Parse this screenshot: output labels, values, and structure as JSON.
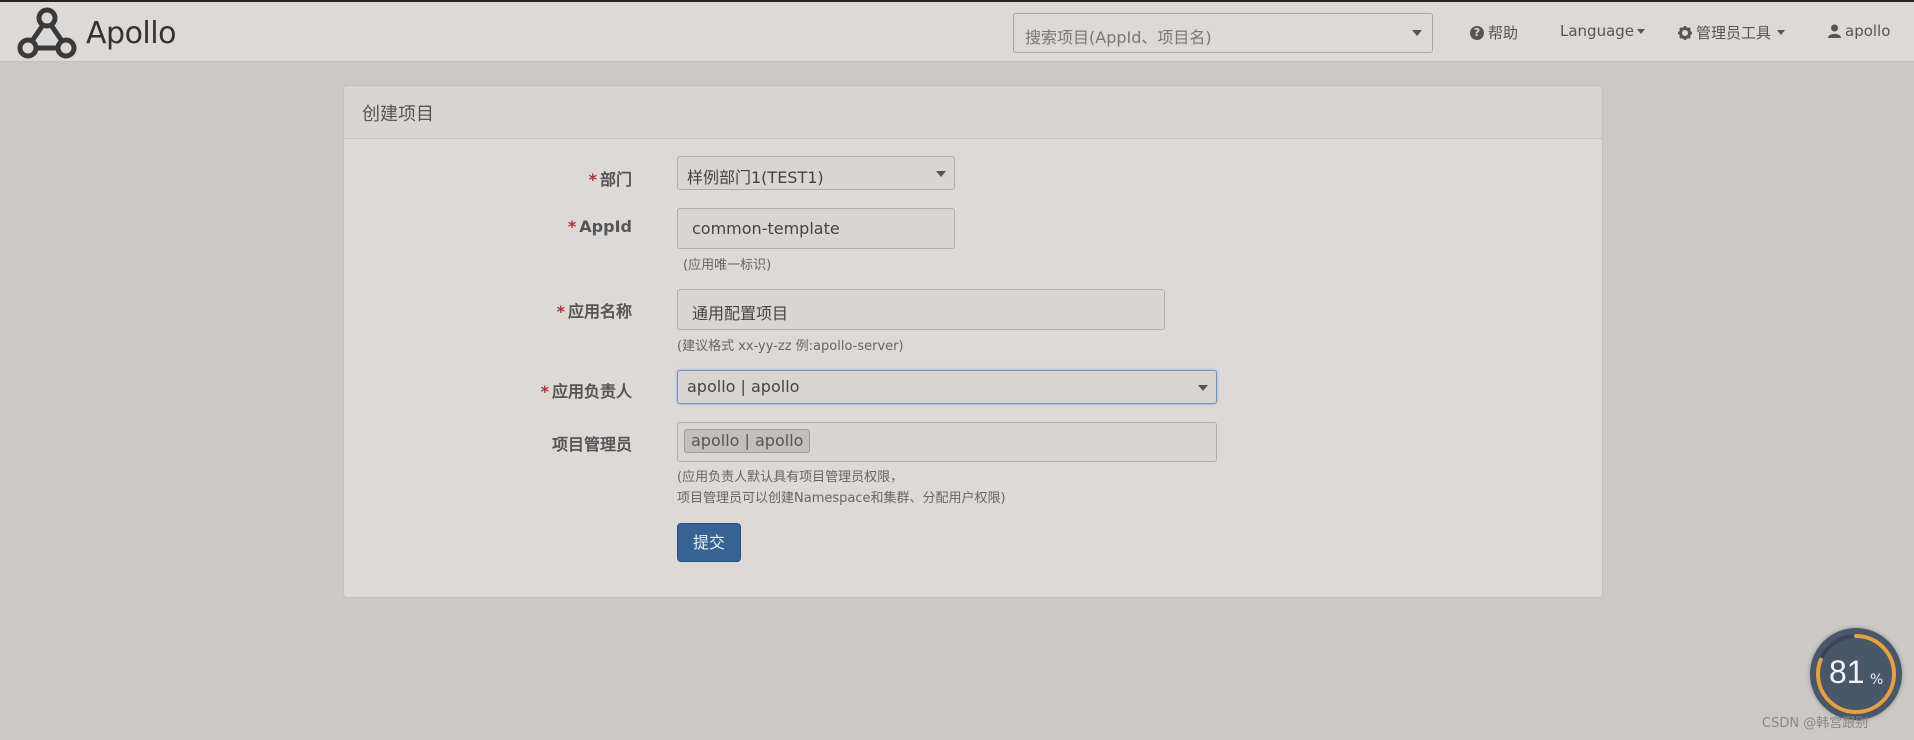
{
  "header": {
    "brand": "Apollo",
    "search_placeholder": "搜索项目(AppId、项目名)",
    "help_label": "帮助",
    "language_label": "Language",
    "admin_tools_label": "管理员工具",
    "user_label": "apollo"
  },
  "panel": {
    "title": "创建项目"
  },
  "form": {
    "required_mark": "*",
    "department": {
      "label": "部门",
      "value": "样例部门1(TEST1)"
    },
    "appid": {
      "label": "AppId",
      "value": "common-template",
      "help": "(应用唯一标识)"
    },
    "app_name": {
      "label": "应用名称",
      "value": "通用配置项目",
      "help": "(建议格式 xx-yy-zz 例:apollo-server)"
    },
    "owner": {
      "label": "应用负责人",
      "value": "apollo | apollo"
    },
    "admins": {
      "label": "项目管理员",
      "tags": [
        "apollo | apollo"
      ],
      "help_line1": "(应用负责人默认具有项目管理员权限，",
      "help_line2": "项目管理员可以创建Namespace和集群、分配用户权限)"
    },
    "submit_label": "提交"
  },
  "widget": {
    "value": "81",
    "unit": "%",
    "progress": 0.81
  },
  "watermark": "CSDN @韩宫跟别"
}
